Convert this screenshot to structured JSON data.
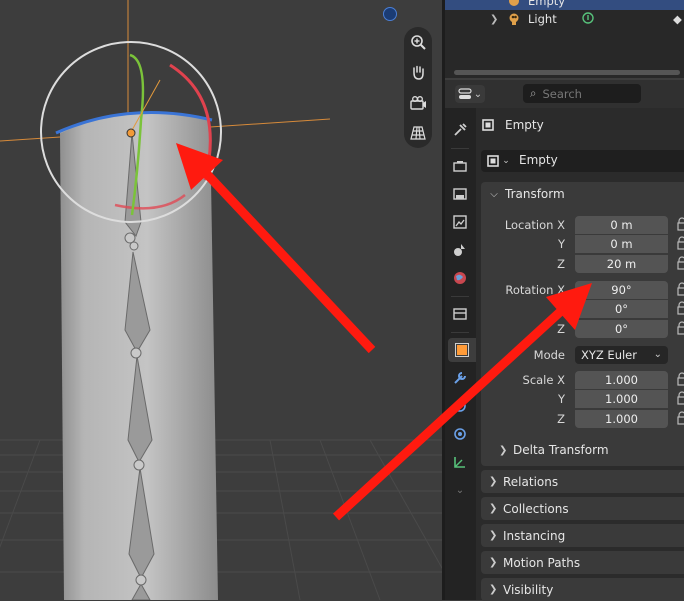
{
  "outliner": {
    "rows": [
      {
        "label": "Empty",
        "selected": true
      },
      {
        "label": "Light",
        "selected": false
      }
    ]
  },
  "props_header": {
    "search_placeholder": "Search"
  },
  "object": {
    "title": "Empty",
    "name_field": "Empty"
  },
  "transform": {
    "header": "Transform",
    "location": {
      "x_label": "Location X",
      "y_label": "Y",
      "z_label": "Z",
      "x": "0 m",
      "y": "0 m",
      "z": "20 m"
    },
    "rotation": {
      "x_label": "Rotation X",
      "y_label": "Y",
      "z_label": "Z",
      "x": "90°",
      "y": "0°",
      "z": "0°"
    },
    "mode": {
      "label": "Mode",
      "value": "XYZ Euler"
    },
    "scale": {
      "x_label": "Scale X",
      "y_label": "Y",
      "z_label": "Z",
      "x": "1.000",
      "y": "1.000",
      "z": "1.000"
    },
    "delta": "Delta Transform"
  },
  "panels": [
    "Relations",
    "Collections",
    "Instancing",
    "Motion Paths",
    "Visibility"
  ],
  "colors": {
    "annotation_arrow": "#ff1a0f",
    "selection": "#334d80",
    "active_tab_icon": "#ff9b38"
  }
}
